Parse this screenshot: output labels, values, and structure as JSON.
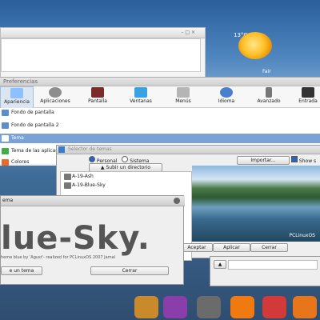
{
  "weather": {
    "temp": "13°C",
    "condition": "Fair"
  },
  "prefs": {
    "title": "Preferencias",
    "toolbar": [
      {
        "label": "Apariencia",
        "icon": "appearance-icon",
        "color": "#8cc0ff"
      },
      {
        "label": "Aplicaciones",
        "icon": "gear-icon",
        "color": "#8d8d8d"
      },
      {
        "label": "Pantalla",
        "icon": "monitor-icon",
        "color": "#7c2b2b"
      },
      {
        "label": "Ventanas",
        "icon": "windows-icon",
        "color": "#39a2e6"
      },
      {
        "label": "Menús",
        "icon": "menu-icon",
        "color": "#b5b5b5"
      },
      {
        "label": "Idioma",
        "icon": "globe-icon",
        "color": "#4a7fd0"
      },
      {
        "label": "Avanzado",
        "icon": "advanced-icon",
        "color": "#777777"
      },
      {
        "label": "Entrada",
        "icon": "keyboard-icon",
        "color": "#333333"
      }
    ],
    "list": [
      {
        "label": "Fondo de pantalla",
        "selected": false
      },
      {
        "label": "Fondo de pantalla 2",
        "selected": false
      },
      {
        "label": "Tema",
        "selected": true
      },
      {
        "label": "Tema de las aplicaciones",
        "selected": false
      },
      {
        "label": "Colores",
        "selected": false
      }
    ]
  },
  "selector": {
    "title": "Selector de temas",
    "radio_personal": "Personal",
    "radio_sistema": "Sistema",
    "subir": "Subir un directorio",
    "importar": "Importar...",
    "show": "Show s",
    "aceptar": "Aceptar",
    "aplicar": "Aplicar",
    "cerrar": "Cerrar",
    "themes": [
      "A-19-Ash",
      "A-19-Blue-Sky"
    ],
    "preview_logo": "PCLinuxOS"
  },
  "dialog": {
    "title": "ema",
    "big": "lue-Sky.",
    "sub": "heme  blue by 'Agust'- realized for PCLinuxOS 2007 Jamal",
    "btn_left": "e un tema",
    "btn_cerrar": "Cerrar"
  },
  "dock": [
    {
      "icon": "folder-icon",
      "color": "#c98a2b"
    },
    {
      "icon": "multimedia-icon",
      "color": "#8a3ea9"
    },
    {
      "icon": "settings-icon",
      "color": "#6b6b6b"
    },
    {
      "icon": "vlc-icon",
      "color": "#f07a10"
    },
    {
      "icon": "mail-icon",
      "color": "#d23a3a"
    },
    {
      "icon": "firefox-icon",
      "color": "#e7761a"
    }
  ]
}
